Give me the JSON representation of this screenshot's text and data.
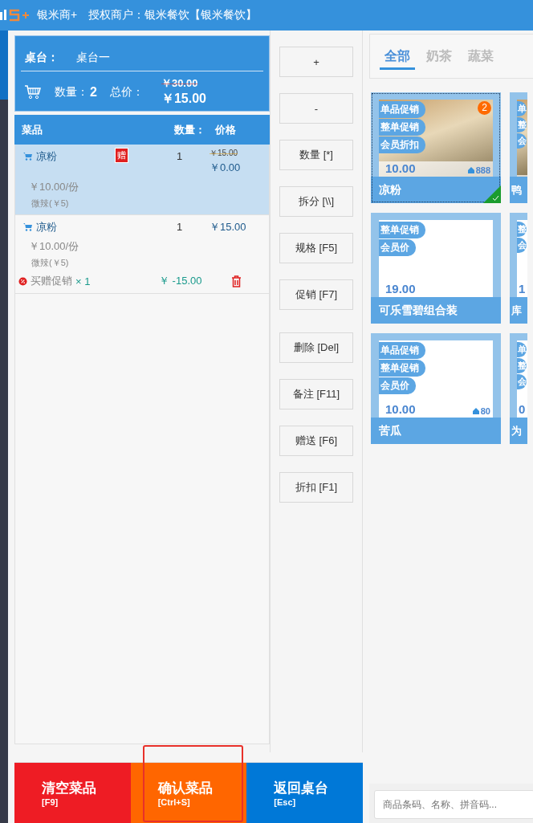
{
  "header": {
    "brand": "银米商+",
    "merchant": "授权商户：银米餐饮【银米餐饮】"
  },
  "summary": {
    "table_label": "桌台：",
    "table_name": "桌台一",
    "qty_label": "数量：",
    "qty": "2",
    "total_label": "总价：",
    "original_total": "￥30.00",
    "total": "￥15.00"
  },
  "order_table": {
    "columns": [
      "菜品",
      "数量：",
      "价格"
    ],
    "rows": [
      {
        "name": "凉粉",
        "gift": "赠",
        "qty": "1",
        "original_price": "￥15.00",
        "price": "￥0.00",
        "unit_price": "￥10.00/份",
        "spec": "微辣(￥5)",
        "selected": true
      },
      {
        "name": "凉粉",
        "qty": "1",
        "price": "￥15.00",
        "unit_price": "￥10.00/份",
        "spec": "微辣(￥5)",
        "selected": false,
        "promotion": {
          "name": "买赠促销",
          "count": "× 1",
          "amount": "￥ -15.00"
        }
      }
    ]
  },
  "actions": [
    {
      "label": "+"
    },
    {
      "label": "-"
    },
    {
      "label": "数量 [*]"
    },
    {
      "label": "拆分 [\\\\]"
    },
    {
      "label": "规格 [F5]"
    },
    {
      "label": "促销 [F7]"
    },
    {
      "label": "删除 [Del]",
      "spaced": true
    },
    {
      "label": "备注 [F11]"
    },
    {
      "label": "赠送 [F6]"
    },
    {
      "label": "折扣 [F1]"
    }
  ],
  "footer_buttons": [
    {
      "kind": "clear",
      "label": "清空菜品",
      "key": "[F9]",
      "highlighted": false
    },
    {
      "kind": "confirm",
      "label": "确认菜品",
      "key": "[Ctrl+S]",
      "highlighted": true
    },
    {
      "kind": "back",
      "label": "返回桌台",
      "key": "[Esc]",
      "highlighted": false
    }
  ],
  "category_tabs": [
    {
      "label": "全部",
      "selected": true
    },
    {
      "label": "奶茶",
      "selected": false
    },
    {
      "label": "蔬菜",
      "selected": false
    }
  ],
  "products": [
    {
      "name": "凉粉",
      "price": "10.00",
      "stock": "888",
      "tags": [
        "单品促销",
        "整单促销",
        "会员折扣"
      ],
      "photo": true,
      "count": "2",
      "partial": false,
      "selected": true
    },
    {
      "name": "鸭",
      "tags": [
        "单",
        "整",
        "会"
      ],
      "photo": true,
      "partial": true,
      "selected": false
    },
    {
      "name": "可乐雪碧组合装",
      "price": "19.00",
      "tags": [
        "整单促销",
        "会员价"
      ],
      "photo": false,
      "partial": false,
      "selected": false
    },
    {
      "name": "库",
      "price": "1",
      "tags": [
        "整",
        "会"
      ],
      "photo": false,
      "partial": true,
      "selected": false
    },
    {
      "name": "苦瓜",
      "price": "10.00",
      "stock": "80",
      "tags": [
        "单品促销",
        "整单促销",
        "会员价"
      ],
      "photo": false,
      "partial": false,
      "selected": false
    },
    {
      "name": "为",
      "price": "0",
      "tags": [
        "单",
        "整",
        "会"
      ],
      "photo": false,
      "partial": true,
      "selected": false
    }
  ],
  "search": {
    "placeholder": "商品条码、名称、拼音码..."
  }
}
